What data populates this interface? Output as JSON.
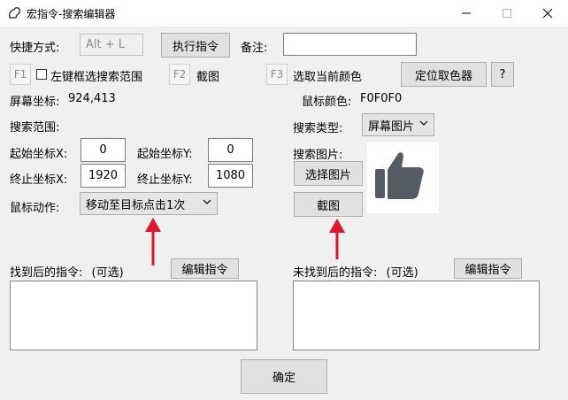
{
  "window": {
    "title": "宏指令-搜索编辑器",
    "minimize_icon": "minimize-icon",
    "maximize_icon": "maximize-icon",
    "close_icon": "close-icon"
  },
  "row1": {
    "hotkey_label": "快捷方式:",
    "hotkey_value": "Alt + L",
    "exec_button": "执行指令",
    "note_label": "备注:",
    "note_value": ""
  },
  "row2": {
    "f1": "F1",
    "left_select_label": "左键框选搜索范围",
    "f2": "F2",
    "screenshot_label": "截图",
    "f3": "F3",
    "pick_color_label": "选取当前颜色",
    "locate_picker_button": "定位取色器",
    "help_button": "?"
  },
  "status": {
    "screen_coords_label": "屏幕坐标:",
    "screen_coords_value": "924,413",
    "mouse_color_label": "鼠标颜色:",
    "mouse_color_value": "F0F0F0"
  },
  "range": {
    "title": "搜索范围:",
    "start_x_label": "起始坐标X:",
    "start_x": "0",
    "start_y_label": "起始坐标Y:",
    "start_y": "0",
    "end_x_label": "终止坐标X:",
    "end_x": "1920",
    "end_y_label": "终止坐标Y:",
    "end_y": "1080",
    "mouse_action_label": "鼠标动作:",
    "mouse_action_value": "移动至目标点击1次"
  },
  "search": {
    "type_label": "搜索类型:",
    "type_value": "屏幕图片",
    "image_label": "搜索图片:",
    "choose_image_button": "选择图片",
    "screenshot_button": "截图",
    "preview_icon": "thumbs-up-icon"
  },
  "found": {
    "label": "找到后的指令:",
    "optional": "(可选)",
    "edit_button": "编辑指令",
    "value": ""
  },
  "not_found": {
    "label": "未找到后的指令:",
    "optional": "(可选)",
    "edit_button": "编辑指令",
    "value": ""
  },
  "confirm_button": "确定",
  "colors": {
    "arrow": "#e0162b",
    "background": "#f0f0f0",
    "thumb": "#555b63"
  }
}
